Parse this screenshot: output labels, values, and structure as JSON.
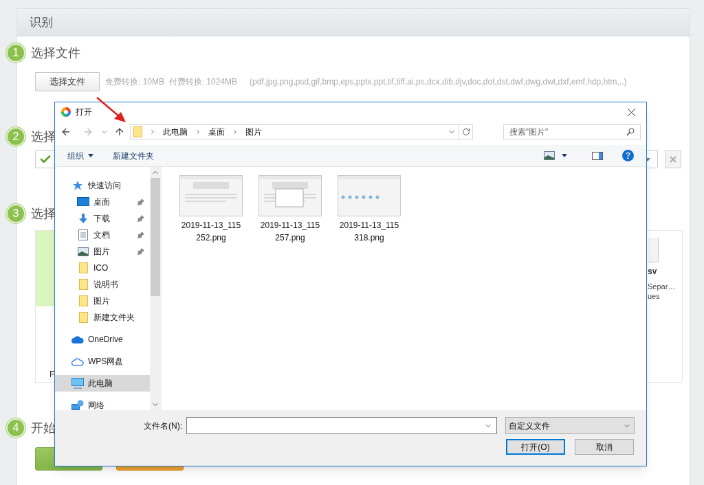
{
  "page": {
    "title": "识别",
    "steps": [
      {
        "number": "1",
        "title": "选择文件"
      },
      {
        "number": "2",
        "title": "选择"
      },
      {
        "number": "3",
        "title": "选择"
      },
      {
        "number": "4",
        "title": "开始"
      }
    ],
    "choose_button": "选择文件",
    "limits": "免费转换: 10MB  付费转换: 1024MB",
    "formats": "(pdf,jpg,png,psd,gif,bmp,eps,pptx,ppt,tif,tiff,ai,ps,dcx,dib,djv,doc,dot,dst,dwf,dwg,dwt,dxf,emf,hdp,htm,..)",
    "step2_checked": true,
    "format_card": {
      "name": "sv",
      "description_line_1": "Separ…",
      "description_line_2": "ues"
    },
    "partial_label": "F"
  },
  "dialog": {
    "title": "打开",
    "breadcrumb": [
      "此电脑",
      "桌面",
      "图片"
    ],
    "search": {
      "placeholder": "搜索\"图片\""
    },
    "toolbar": [
      "组织",
      "新建文件夹"
    ],
    "sidebar": [
      {
        "label": "快速访问",
        "kind": "star",
        "selected": false,
        "children": [
          {
            "label": "桌面",
            "kind": "desktop",
            "pinned": true,
            "selected": false
          },
          {
            "label": "下载",
            "kind": "download",
            "pinned": true,
            "selected": false
          },
          {
            "label": "文档",
            "kind": "document",
            "pinned": true,
            "selected": false
          },
          {
            "label": "图片",
            "kind": "picture",
            "pinned": true,
            "selected": false
          },
          {
            "label": "ICO",
            "kind": "folder",
            "pinned": false,
            "selected": false
          },
          {
            "label": "说明书",
            "kind": "folder",
            "pinned": false,
            "selected": false
          },
          {
            "label": "图片",
            "kind": "folder",
            "pinned": false,
            "selected": false
          },
          {
            "label": "新建文件夹",
            "kind": "folder",
            "pinned": false,
            "selected": false
          }
        ]
      },
      {
        "label": "OneDrive",
        "kind": "cloud",
        "selected": false
      },
      {
        "label": "WPS网盘",
        "kind": "cloud-outline",
        "selected": false
      },
      {
        "label": "此电脑",
        "kind": "pc",
        "selected": true
      },
      {
        "label": "网络",
        "kind": "network",
        "selected": false
      }
    ],
    "files": [
      {
        "name_line_1": "2019-11-13_115",
        "name_line_2": "252.png"
      },
      {
        "name_line_1": "2019-11-13_115",
        "name_line_2": "257.png"
      },
      {
        "name_line_1": "2019-11-13_115",
        "name_line_2": "318.png"
      }
    ],
    "filename_label": "文件名(N):",
    "file_type": "自定义文件",
    "buttons": [
      {
        "label": "打开(O)",
        "default": true
      },
      {
        "label": "取消",
        "default": false
      }
    ]
  }
}
